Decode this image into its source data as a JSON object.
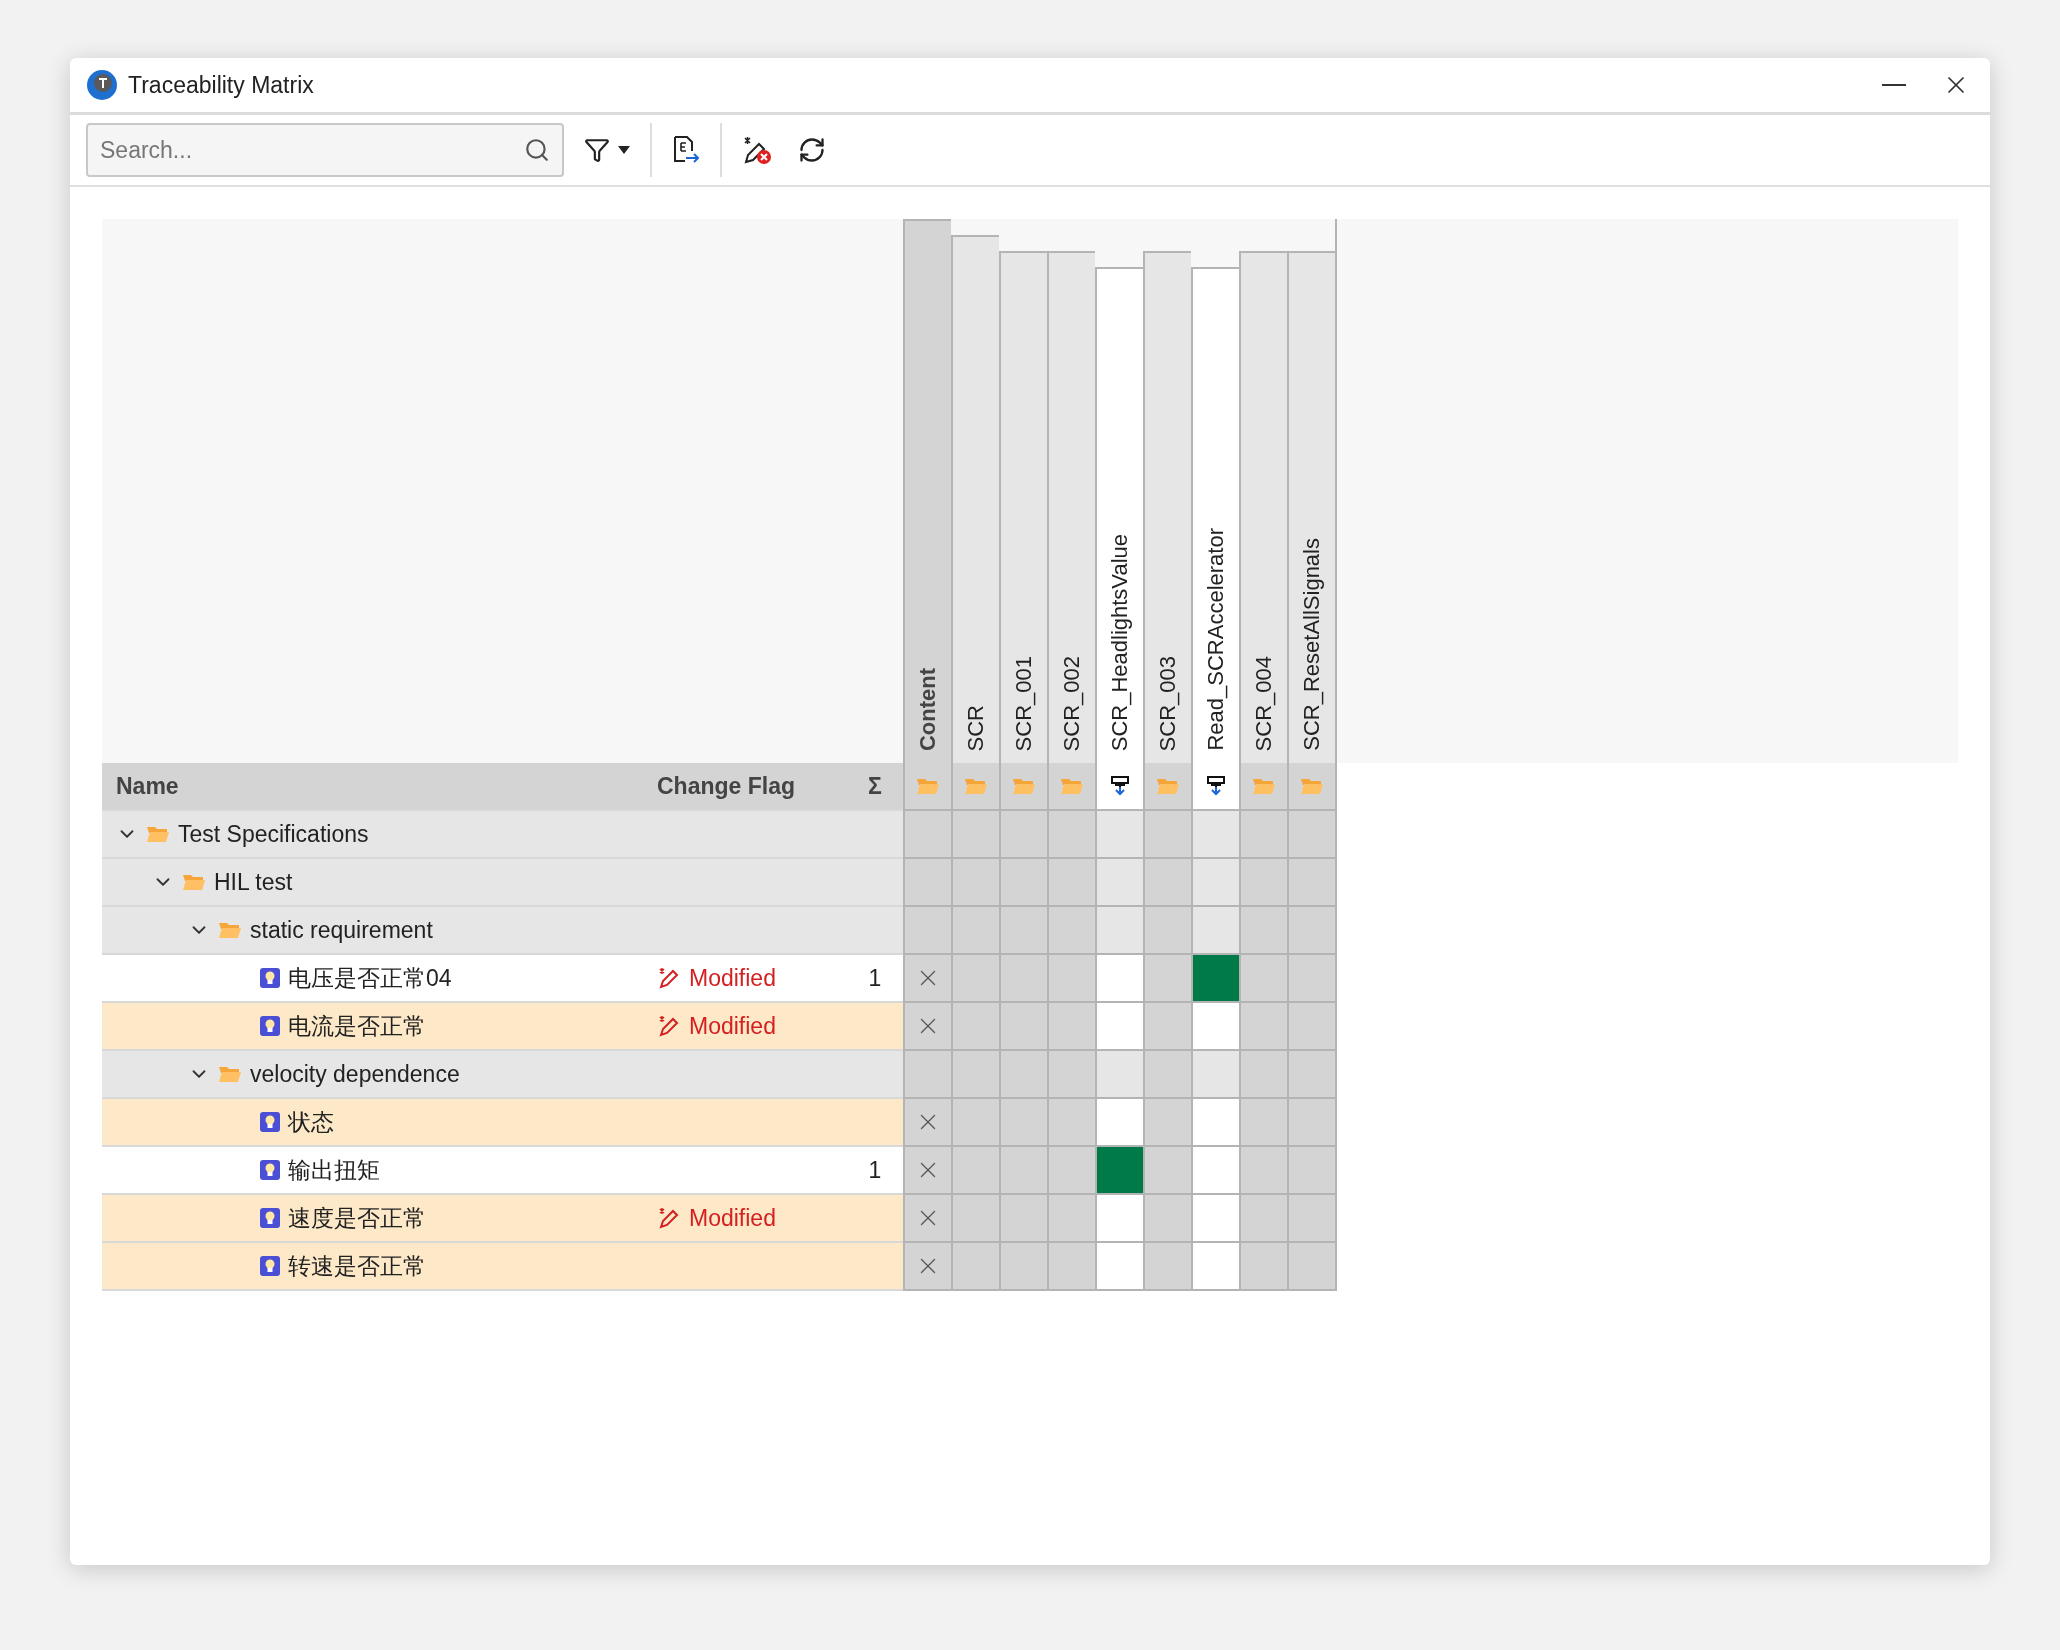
{
  "window": {
    "title": "Traceability Matrix"
  },
  "toolbar": {
    "search": {
      "placeholder": "Search..."
    }
  },
  "matrix": {
    "columns": [
      {
        "label": "Content",
        "kind": "root",
        "children": [
          {
            "label": "SCR",
            "kind": "folder",
            "children": [
              {
                "label": "SCR_001",
                "kind": "folder"
              },
              {
                "label": "SCR_002",
                "kind": "folder",
                "children": [
                  {
                    "label": "SCR_HeadlightsValue",
                    "kind": "item"
                  }
                ]
              },
              {
                "label": "SCR_003",
                "kind": "folder",
                "children": [
                  {
                    "label": "Read_SCRAccelerator",
                    "kind": "item"
                  }
                ]
              },
              {
                "label": "SCR_004",
                "kind": "folder"
              },
              {
                "label": "SCR_ResetAllSignals",
                "kind": "folder"
              }
            ]
          }
        ]
      }
    ],
    "header": {
      "name": "Name",
      "change_flag": "Change Flag",
      "sum": "Σ"
    },
    "rows": [
      {
        "name": "Test Specifications",
        "kind": "folder",
        "expanded": true,
        "children": [
          {
            "name": "HIL test",
            "kind": "folder",
            "expanded": true,
            "children": [
              {
                "name": "static requirement",
                "kind": "folder",
                "expanded": true,
                "children": [
                  {
                    "name": "电压是否正常04",
                    "kind": "requirement",
                    "highlighted": false,
                    "change_flag": "Modified",
                    "sum": "1",
                    "crossed": true,
                    "links": [
                      false,
                      false,
                      false,
                      false,
                      false,
                      true,
                      false,
                      false
                    ]
                  },
                  {
                    "name": "电流是否正常",
                    "kind": "requirement",
                    "highlighted": true,
                    "change_flag": "Modified",
                    "crossed": true,
                    "links": [
                      false,
                      false,
                      false,
                      false,
                      false,
                      false,
                      false,
                      false
                    ]
                  }
                ]
              },
              {
                "name": "velocity dependence",
                "kind": "folder",
                "expanded": true,
                "children": [
                  {
                    "name": "状态",
                    "kind": "requirement",
                    "highlighted": true,
                    "crossed": true,
                    "links": [
                      false,
                      false,
                      false,
                      false,
                      false,
                      false,
                      false,
                      false
                    ]
                  },
                  {
                    "name": "输出扭矩",
                    "kind": "requirement",
                    "highlighted": false,
                    "sum": "1",
                    "crossed": true,
                    "links": [
                      false,
                      false,
                      false,
                      true,
                      false,
                      false,
                      false,
                      false
                    ]
                  },
                  {
                    "name": "速度是否正常",
                    "kind": "requirement",
                    "highlighted": true,
                    "change_flag": "Modified",
                    "crossed": true,
                    "links": [
                      false,
                      false,
                      false,
                      false,
                      false,
                      false,
                      false,
                      false
                    ]
                  },
                  {
                    "name": "转速是否正常",
                    "kind": "requirement",
                    "highlighted": true,
                    "crossed": true,
                    "links": [
                      false,
                      false,
                      false,
                      false,
                      false,
                      false,
                      false,
                      false
                    ]
                  }
                ]
              }
            ]
          }
        ]
      }
    ]
  }
}
